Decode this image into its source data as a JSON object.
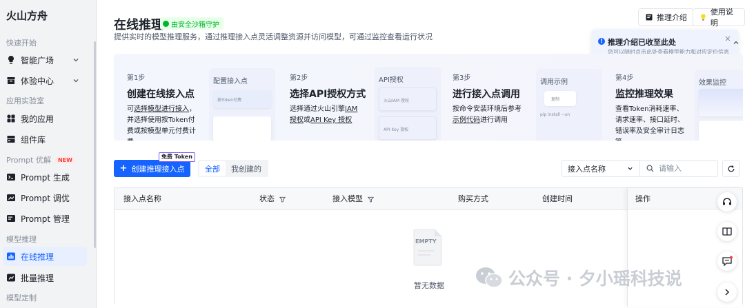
{
  "sidebar": {
    "brand": "火山方舟",
    "sections": {
      "quick_start": "快速开始",
      "app_lab": "应用实验室",
      "prompt_opt": "Prompt 优解",
      "prompt_new": "NEW",
      "model_inference": "模型推理",
      "model_custom": "模型定制"
    },
    "items": {
      "model_square": "智能广场",
      "experience": "体验中心",
      "my_apps": "我的应用",
      "components": "组件库",
      "prompt_gen": "Prompt 生成",
      "prompt_tune": "Prompt 调优",
      "prompt_manage": "Prompt 管理",
      "online_infer": "在线推理",
      "batch_infer": "批量推理"
    }
  },
  "header": {
    "title": "在线推理",
    "secure_badge": "由安全沙箱守护",
    "description": "提供实时的模型推理服务，通过推理接入点灵活调整资源并访问模型，可通过监控查看运行状况",
    "intro_btn": "推理介绍",
    "help_btn": "使用说明"
  },
  "tooltip": {
    "title": "推理介绍已收至此处",
    "subtitle": "您可以随时点击此处查看模型能力和对应定价信息"
  },
  "steps": [
    {
      "num": "第1步",
      "title": "创建在线接入点",
      "desc_pre": "可",
      "desc_link": "选择模型进行接入",
      "desc_post": "，并选择使用按Token付费或按模型单元付费计费",
      "preview_title": "配置接入点",
      "preview_card": "按Token付费"
    },
    {
      "num": "第2步",
      "title": "选择API授权方式",
      "desc_pre": "选择通过火山引擎",
      "desc_link": "IAM 授权",
      "desc_mid": "或",
      "desc_link2": "API Key 授权",
      "preview_title": "API授权",
      "preview_card": "火山IAM 授权",
      "preview_card2": "API Key 授权"
    },
    {
      "num": "第3步",
      "title": "进行接入点调用",
      "desc_pre": "按命令安装环境后参考",
      "desc_link": "示例代码",
      "desc_post": "进行调用",
      "preview_title": "调用示例",
      "preview_card": "复制",
      "preview_code": "pip install --un"
    },
    {
      "num": "第4步",
      "title": "监控推理效果",
      "desc": "查看Token消耗速率、请求速率、接口延时、错误率及安全审计日志等",
      "preview_title": "效果监控"
    }
  ],
  "toolbar": {
    "create_label": "创建推理接入点",
    "free_tag": "免费 Token",
    "seg_all": "全部",
    "seg_mine": "我创建的",
    "filter_select": "接入点名称",
    "search_placeholder": "请输入"
  },
  "table": {
    "columns": [
      "接入点名称",
      "状态",
      "接入模型",
      "购买方式",
      "创建时间",
      "操作"
    ],
    "empty_icon_text": "EMPTY",
    "empty_text": "暂无数据"
  },
  "watermark": {
    "text": "公众号 · 夕小瑶科技说"
  },
  "colors": {
    "accent": "#1664ff",
    "secure_green": "#00b42a",
    "new_red": "#f53f3f",
    "free_tag_border": "#7e59f7"
  }
}
